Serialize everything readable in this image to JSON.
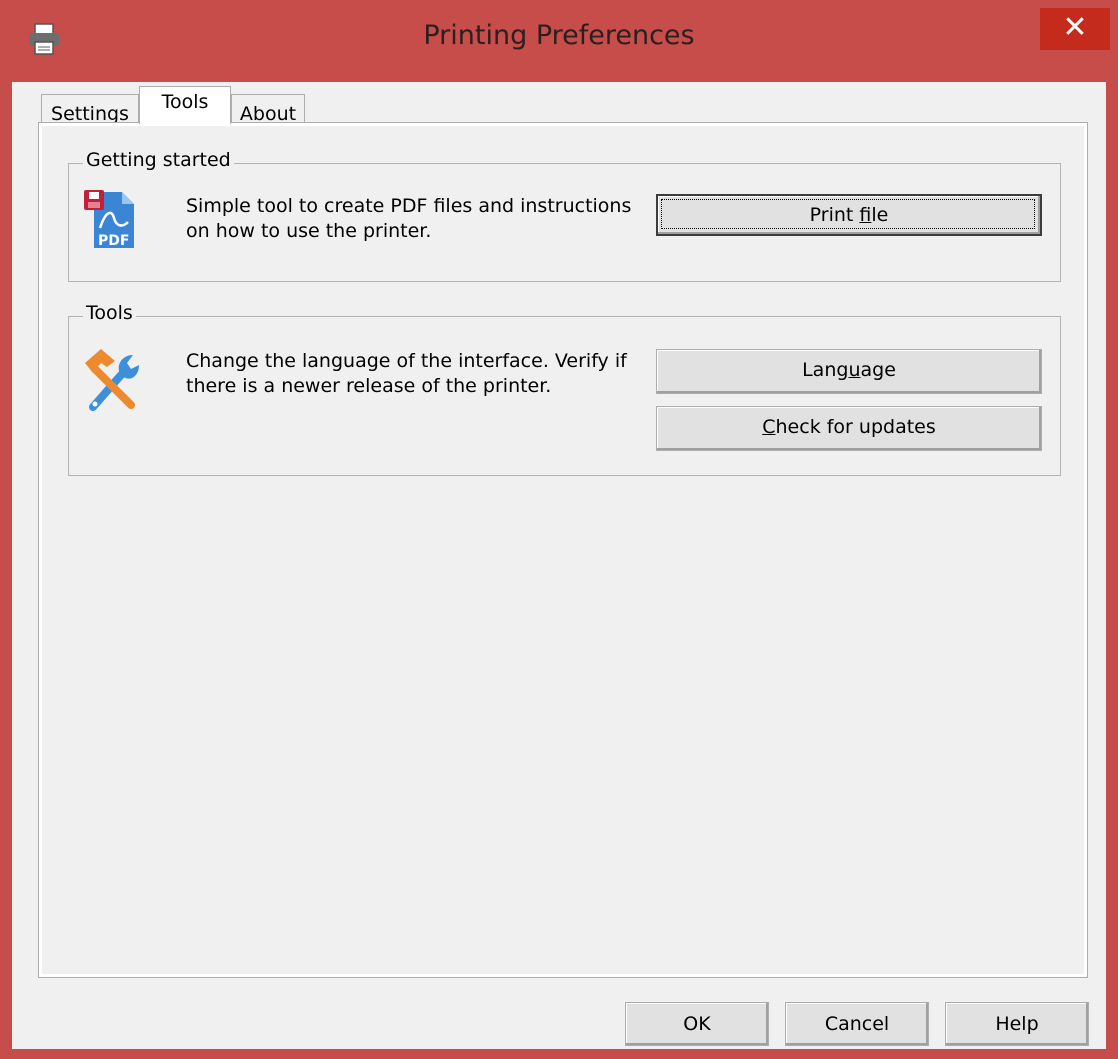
{
  "window": {
    "title": "Printing Preferences",
    "close_glyph": "✕",
    "accent_color": "#c64d4a"
  },
  "tabs": [
    {
      "label": "Settings",
      "active": false
    },
    {
      "label": "Tools",
      "active": true
    },
    {
      "label": "About",
      "active": false
    }
  ],
  "getting_started": {
    "legend": "Getting started",
    "icon": "pdf-file-icon",
    "description_line1": "Simple tool to create PDF files and instructions",
    "description_line2": "on how to use the printer.",
    "print_button_pre": "Print ",
    "print_button_accel": "f",
    "print_button_post": "ile",
    "pdf_icon_text": "PDF"
  },
  "tools": {
    "legend": "Tools",
    "icon": "tools-icon",
    "description_line1": "Change the language of the interface. Verify if",
    "description_line2": "there is a newer release of the printer.",
    "language_button_pre": "Lang",
    "language_button_accel": "u",
    "language_button_post": "age",
    "updates_button_accel": "C",
    "updates_button_post": "heck for updates"
  },
  "footer": {
    "ok_label": "OK",
    "cancel_label": "Cancel",
    "help_label": "Help"
  }
}
